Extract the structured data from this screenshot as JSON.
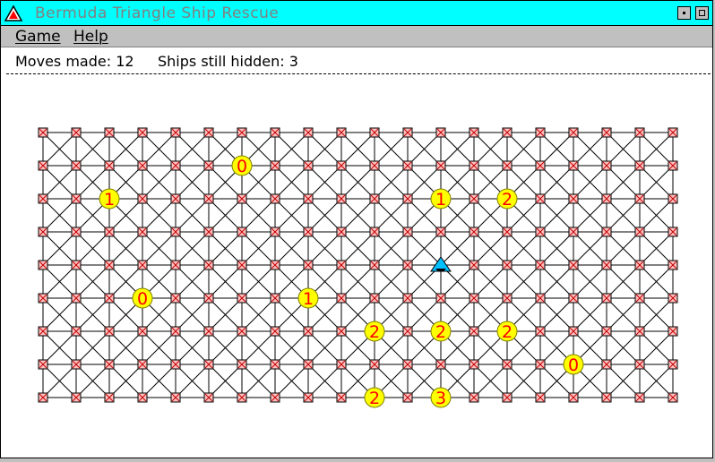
{
  "window": {
    "title": "Bermuda Triangle Ship Rescue"
  },
  "menu": {
    "game": "Game",
    "help": "Help"
  },
  "status": {
    "moves_made": "Moves made: 12",
    "ships_hidden": "Ships still hidden: 3"
  },
  "board": {
    "cols": 20,
    "rows": 9,
    "colors": {
      "line": "#000000",
      "cell_fill": "#ffc0c0",
      "cell_border": "#000000",
      "cell_cross": "#c00000",
      "number_fill": "#ffff00",
      "number_text": "#ff0000",
      "ship_color": "#00c0ff"
    },
    "numbers": [
      {
        "row": 1,
        "col": 6,
        "text": "0"
      },
      {
        "row": 2,
        "col": 2,
        "text": "1"
      },
      {
        "row": 2,
        "col": 12,
        "text": "1"
      },
      {
        "row": 2,
        "col": 14,
        "text": "2"
      },
      {
        "row": 5,
        "col": 3,
        "text": "0"
      },
      {
        "row": 5,
        "col": 8,
        "text": "1"
      },
      {
        "row": 6,
        "col": 10,
        "text": "2"
      },
      {
        "row": 6,
        "col": 12,
        "text": "2"
      },
      {
        "row": 6,
        "col": 14,
        "text": "2"
      },
      {
        "row": 7,
        "col": 16,
        "text": "0"
      },
      {
        "row": 8,
        "col": 10,
        "text": "2"
      },
      {
        "row": 8,
        "col": 12,
        "text": "3"
      }
    ],
    "ship": {
      "row": 4,
      "col": 12,
      "icon": "ship-triangle-icon"
    }
  }
}
